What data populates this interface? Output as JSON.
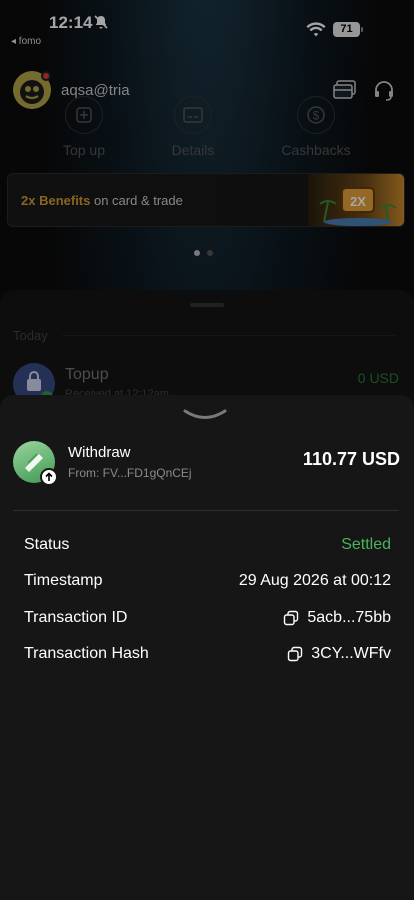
{
  "status_bar": {
    "time": "12:14",
    "back_app": "◂ fomo",
    "battery": "71"
  },
  "profile": {
    "username": "aqsa@tria"
  },
  "actions": [
    {
      "label": "Top up",
      "icon": "plus-icon"
    },
    {
      "label": "Details",
      "icon": "card-details-icon"
    },
    {
      "label": "Cashbacks",
      "icon": "dollar-icon"
    }
  ],
  "benefits": {
    "highlight": "2x Benefits",
    "text": " on card & trade",
    "badge": "2X"
  },
  "history": {
    "section": "Today",
    "item": {
      "title": "Topup",
      "subtitle": "Received at 12:12am",
      "amount": "0 USD"
    }
  },
  "detail": {
    "title": "Withdraw",
    "from": "From: FV...FD1gQnCEj",
    "amount": "110.77 USD",
    "rows": [
      {
        "label": "Status",
        "value": "Settled",
        "color": "#49b35d"
      },
      {
        "label": "Timestamp",
        "value": "29 Aug 2026 at 00:12"
      },
      {
        "label": "Transaction ID",
        "value": "5acb...75bb",
        "copy": true
      },
      {
        "label": "Transaction Hash",
        "value": "3CY...WFfv",
        "copy": true
      }
    ]
  }
}
